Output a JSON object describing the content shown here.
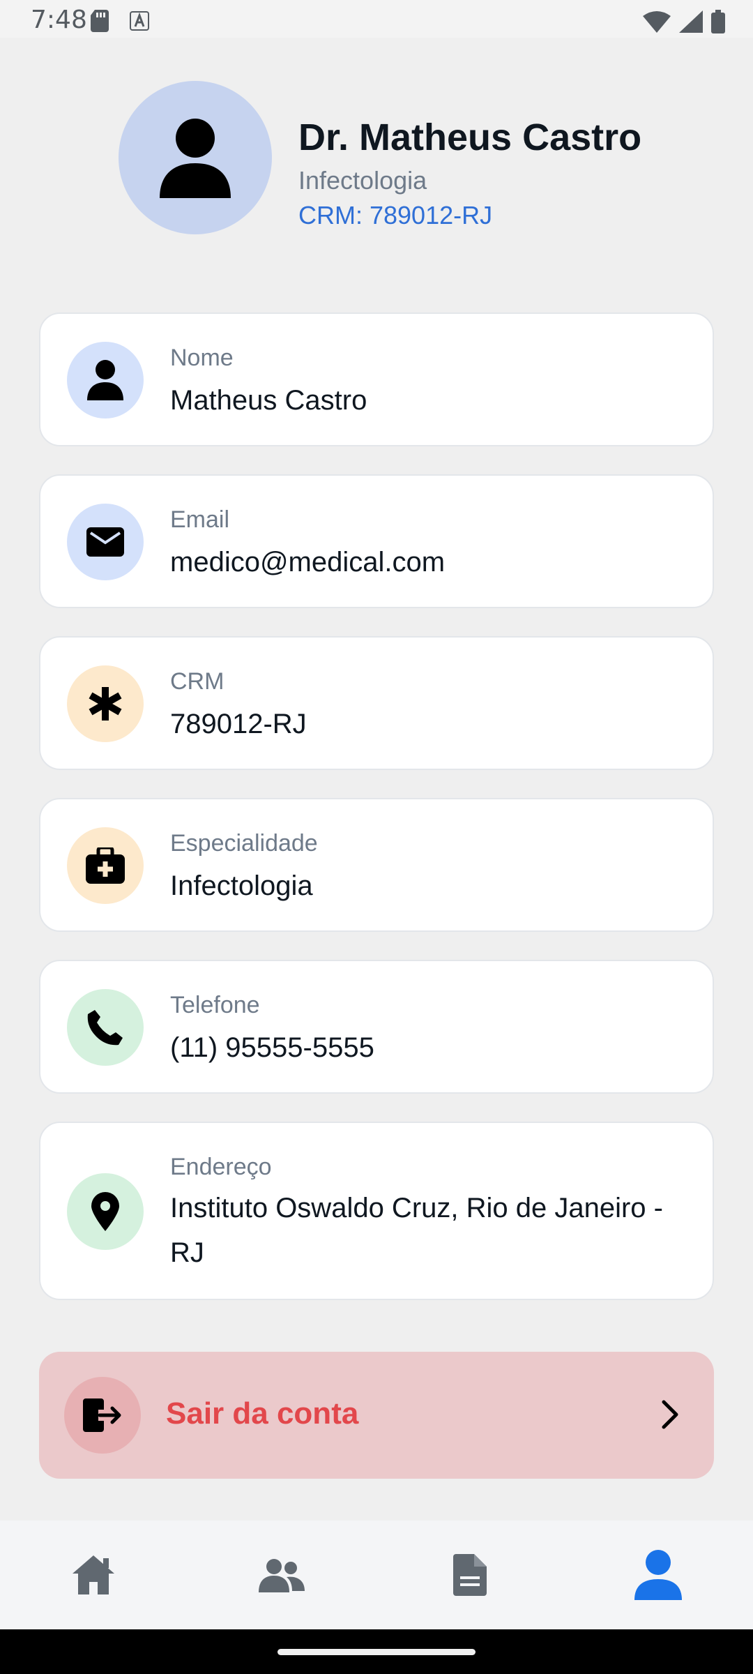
{
  "status_bar": {
    "time": "7:48"
  },
  "profile": {
    "name": "Dr. Matheus Castro",
    "specialty": "Infectologia",
    "crm": "CRM: 789012-RJ"
  },
  "info_cards": [
    {
      "label": "Nome",
      "value": "Matheus Castro",
      "icon": "person-icon",
      "icon_bg": "#d4e1fb"
    },
    {
      "label": "Email",
      "value": "medico@medical.com",
      "icon": "envelope-icon",
      "icon_bg": "#d4e1fb"
    },
    {
      "label": "CRM",
      "value": "789012-RJ",
      "icon": "asterisk-icon",
      "icon_bg": "#fde9cc"
    },
    {
      "label": "Especialidade",
      "value": "Infectologia",
      "icon": "medical-bag-icon",
      "icon_bg": "#fde9cc"
    },
    {
      "label": "Telefone",
      "value": "(11) 95555-5555",
      "icon": "phone-icon",
      "icon_bg": "#d5f1de"
    },
    {
      "label": "Endereço",
      "value": "Instituto Oswaldo Cruz, Rio de Janeiro - RJ",
      "icon": "location-pin-icon",
      "icon_bg": "#d5f1de"
    }
  ],
  "logout": {
    "label": "Sair da conta",
    "color": "#e2474b"
  },
  "bottom_nav": {
    "items": [
      "home-icon",
      "patients-icon",
      "document-icon",
      "profile-icon"
    ],
    "active": "profile-icon",
    "active_color": "#1a73e8"
  }
}
